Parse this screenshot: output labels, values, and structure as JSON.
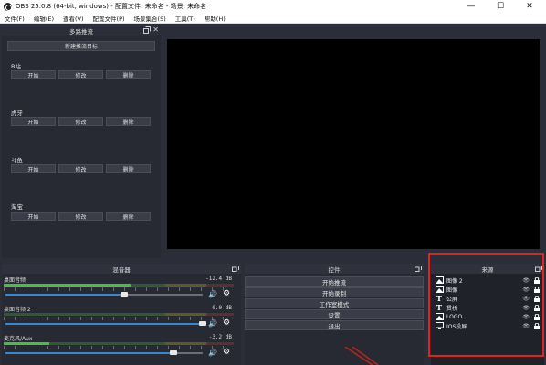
{
  "window": {
    "title": "OBS 25.0.8 (64-bit, windows) - 配置文件: 未命名 - 场景: 未命名",
    "minimize_glyph": "—",
    "maximize_glyph": "☐",
    "close_glyph": "✕"
  },
  "menu": [
    "文件(F)",
    "编辑(E)",
    "查看(V)",
    "配置文件(P)",
    "场景集合(S)",
    "工具(T)",
    "帮助(H)"
  ],
  "multistream": {
    "title": "多路推流",
    "new_target_label": "新建推流目标",
    "close_glyph": "✕",
    "platforms": [
      {
        "name": "B站",
        "start": "开始",
        "edit": "修改",
        "delete": "删除"
      },
      {
        "name": "虎牙",
        "start": "开始",
        "edit": "修改",
        "delete": "删除"
      },
      {
        "name": "斗鱼",
        "start": "开始",
        "edit": "修改",
        "delete": "删除"
      },
      {
        "name": "淘宝",
        "start": "开始",
        "edit": "修改",
        "delete": "删除"
      }
    ]
  },
  "mixer": {
    "title": "混音器",
    "tracks": [
      {
        "name": "桌面音频",
        "db": "-12.4 dB",
        "level": 0.55,
        "volume": 0.6
      },
      {
        "name": "桌面音频 2",
        "db": "0.0 dB",
        "level": 0.0,
        "volume": 1.0
      },
      {
        "name": "麦克风/Aux",
        "db": "-3.2 dB",
        "level": 0.2,
        "volume": 0.85
      }
    ]
  },
  "controls": {
    "title": "控件",
    "buttons": [
      "开始推流",
      "开始录制",
      "工作室模式",
      "设置",
      "退出"
    ]
  },
  "sources": {
    "title": "来源",
    "items": [
      {
        "name": "图像 2",
        "icon": "image-icon"
      },
      {
        "name": "图像",
        "icon": "image-icon"
      },
      {
        "name": "公屏",
        "icon": "text-icon"
      },
      {
        "name": "贯桥",
        "icon": "text-icon"
      },
      {
        "name": "LOGO",
        "icon": "image-icon"
      },
      {
        "name": "IOS投屏",
        "icon": "display-icon"
      }
    ]
  },
  "colors": {
    "highlight": "#e0231c",
    "accent": "#3a86c8",
    "meter_green": "#45c045"
  }
}
